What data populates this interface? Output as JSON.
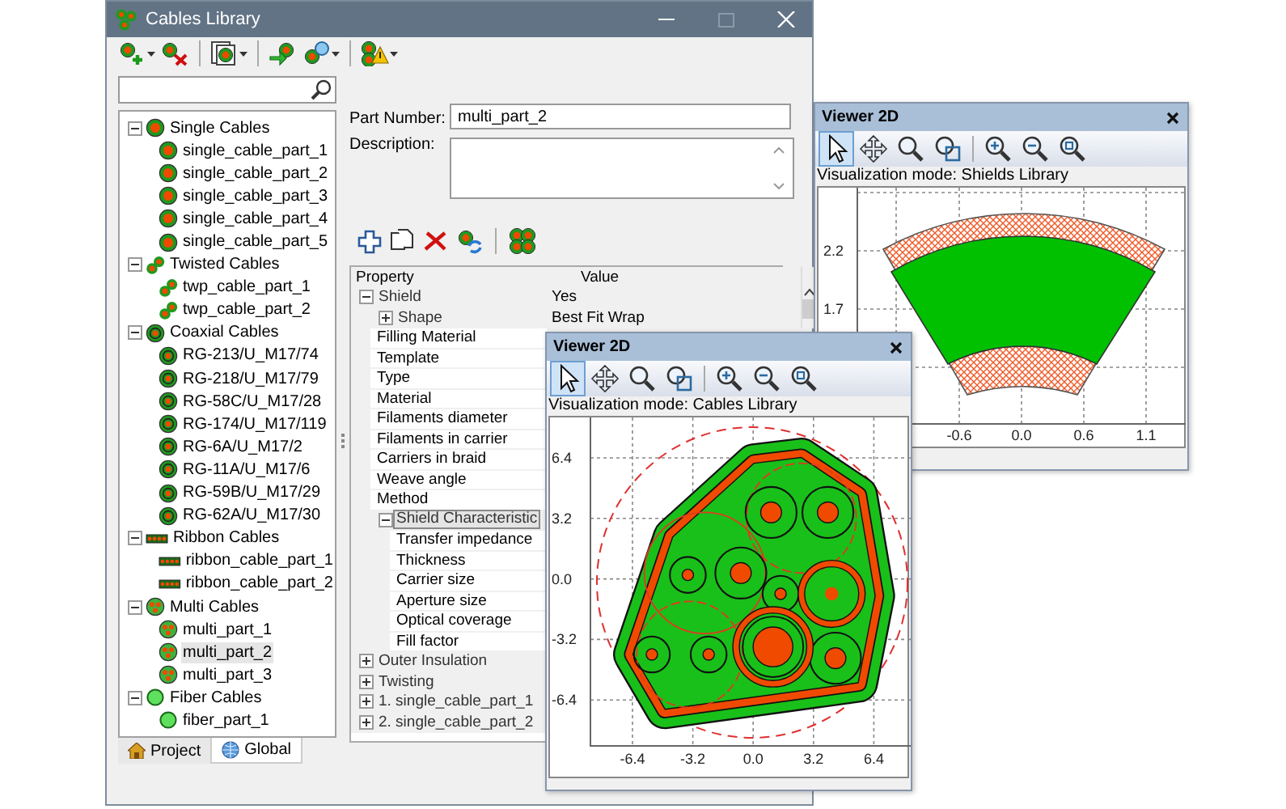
{
  "window": {
    "title": "Cables Library"
  },
  "tree": [
    {
      "label": "Single Cables",
      "kind": "single",
      "expanded": true,
      "selected": false,
      "children": [
        {
          "label": "single_cable_part_1",
          "kind": "single",
          "selected": false
        },
        {
          "label": "single_cable_part_2",
          "kind": "single",
          "selected": false
        },
        {
          "label": "single_cable_part_3",
          "kind": "single",
          "selected": false
        },
        {
          "label": "single_cable_part_4",
          "kind": "single",
          "selected": false
        },
        {
          "label": "single_cable_part_5",
          "kind": "single",
          "selected": false
        }
      ]
    },
    {
      "label": "Twisted Cables",
      "kind": "twisted",
      "expanded": true,
      "selected": false,
      "children": [
        {
          "label": "twp_cable_part_1",
          "kind": "twisted",
          "selected": false
        },
        {
          "label": "twp_cable_part_2",
          "kind": "twisted",
          "selected": false
        }
      ]
    },
    {
      "label": "Coaxial Cables",
      "kind": "coaxial",
      "expanded": true,
      "selected": false,
      "children": [
        {
          "label": "RG-213/U_M17/74",
          "kind": "coaxial",
          "selected": false
        },
        {
          "label": "RG-218/U_M17/79",
          "kind": "coaxial",
          "selected": false
        },
        {
          "label": "RG-58C/U_M17/28",
          "kind": "coaxial",
          "selected": false
        },
        {
          "label": "RG-174/U_M17/119",
          "kind": "coaxial",
          "selected": false
        },
        {
          "label": "RG-6A/U_M17/2",
          "kind": "coaxial",
          "selected": false
        },
        {
          "label": "RG-11A/U_M17/6",
          "kind": "coaxial",
          "selected": false
        },
        {
          "label": "RG-59B/U_M17/29",
          "kind": "coaxial",
          "selected": false
        },
        {
          "label": "RG-62A/U_M17/30",
          "kind": "coaxial",
          "selected": false
        }
      ]
    },
    {
      "label": "Ribbon Cables",
      "kind": "ribbon",
      "expanded": true,
      "selected": false,
      "children": [
        {
          "label": "ribbon_cable_part_1",
          "kind": "ribbon",
          "selected": false
        },
        {
          "label": "ribbon_cable_part_2",
          "kind": "ribbon",
          "selected": false
        }
      ]
    },
    {
      "label": "Multi Cables",
      "kind": "multi",
      "expanded": true,
      "selected": false,
      "children": [
        {
          "label": "multi_part_1",
          "kind": "multi",
          "selected": false
        },
        {
          "label": "multi_part_2",
          "kind": "multi",
          "selected": true
        },
        {
          "label": "multi_part_3",
          "kind": "multi",
          "selected": false
        }
      ]
    },
    {
      "label": "Fiber Cables",
      "kind": "fiber",
      "expanded": true,
      "selected": false,
      "children": [
        {
          "label": "fiber_part_1",
          "kind": "fiber",
          "selected": false
        }
      ]
    }
  ],
  "tabs": [
    {
      "label": "Project",
      "kind": "home",
      "selected": false
    },
    {
      "label": "Global",
      "kind": "globe",
      "selected": true
    }
  ],
  "form": {
    "part_number_label": "Part Number:",
    "part_number": "multi_part_2",
    "description_label": "Description:"
  },
  "properties": {
    "columns": [
      "Property",
      "Value"
    ],
    "rows": [
      {
        "kind": "category",
        "name": "Shield",
        "value": "Yes",
        "expanded": true,
        "selected": false,
        "children": [
          {
            "kind": "category",
            "name": "Shape",
            "value": "Best Fit Wrap",
            "expanded": false,
            "selected": false
          },
          {
            "kind": "property",
            "name": "Filling Material",
            "selected": false
          },
          {
            "kind": "property",
            "name": "Template",
            "selected": false
          },
          {
            "kind": "property",
            "name": "Type",
            "selected": false
          },
          {
            "kind": "property",
            "name": "Material",
            "selected": false
          },
          {
            "kind": "property",
            "name": "Filaments diameter",
            "selected": false
          },
          {
            "kind": "property",
            "name": "Filaments in carrier",
            "selected": false
          },
          {
            "kind": "property",
            "name": "Carriers in braid",
            "selected": false
          },
          {
            "kind": "property",
            "name": "Weave angle",
            "selected": false
          },
          {
            "kind": "property",
            "name": "Method",
            "selected": false
          },
          {
            "kind": "category",
            "name": "Shield Characteristic",
            "expanded": true,
            "selected": true,
            "children": [
              {
                "kind": "property",
                "name": "Transfer impedance",
                "selected": false
              },
              {
                "kind": "property",
                "name": "Thickness",
                "selected": false
              },
              {
                "kind": "property",
                "name": "Carrier size",
                "selected": false
              },
              {
                "kind": "property",
                "name": "Aperture size",
                "selected": false
              },
              {
                "kind": "property",
                "name": "Optical coverage",
                "selected": false
              },
              {
                "kind": "property",
                "name": "Fill factor",
                "selected": false
              }
            ]
          }
        ]
      },
      {
        "kind": "category",
        "name": "Outer Insulation",
        "expanded": false,
        "selected": false
      },
      {
        "kind": "category",
        "name": "Twisting",
        "expanded": false,
        "selected": false
      },
      {
        "kind": "category",
        "name": "1. single_cable_part_1",
        "expanded": false,
        "selected": false
      },
      {
        "kind": "category",
        "name": "2. single_cable_part_2",
        "expanded": false,
        "selected": false
      }
    ]
  },
  "viewers": [
    {
      "title": "Viewer 2D",
      "mode": "Visualization mode: Shields Library",
      "kind": "shield",
      "tools": [
        {
          "kind": "pointer",
          "selected": true
        },
        {
          "kind": "pan",
          "selected": false
        },
        {
          "kind": "zoom",
          "selected": false
        },
        {
          "kind": "zoom-window",
          "selected": false
        },
        {
          "kind": "zoom-in",
          "selected": false
        },
        {
          "kind": "zoom-out",
          "selected": false
        },
        {
          "kind": "zoom-fit",
          "selected": false
        }
      ],
      "y_ticks": [
        "2.2",
        "1.7"
      ],
      "x_ticks": [
        "-0.6",
        "0.0",
        "0.6",
        "1.1"
      ]
    },
    {
      "title": "Viewer 2D",
      "mode": "Visualization mode: Cables Library",
      "kind": "cable",
      "tools": [
        {
          "kind": "pointer",
          "selected": true
        },
        {
          "kind": "pan",
          "selected": false
        },
        {
          "kind": "zoom",
          "selected": false
        },
        {
          "kind": "zoom-window",
          "selected": false
        },
        {
          "kind": "zoom-in",
          "selected": false
        },
        {
          "kind": "zoom-out",
          "selected": false
        },
        {
          "kind": "zoom-fit",
          "selected": false
        }
      ],
      "y_ticks": [
        "6.4",
        "3.2",
        "0.0",
        "-3.2",
        "-6.4"
      ],
      "x_ticks": [
        "-6.4",
        "-3.2",
        "0.0",
        "3.2",
        "6.4"
      ]
    }
  ]
}
